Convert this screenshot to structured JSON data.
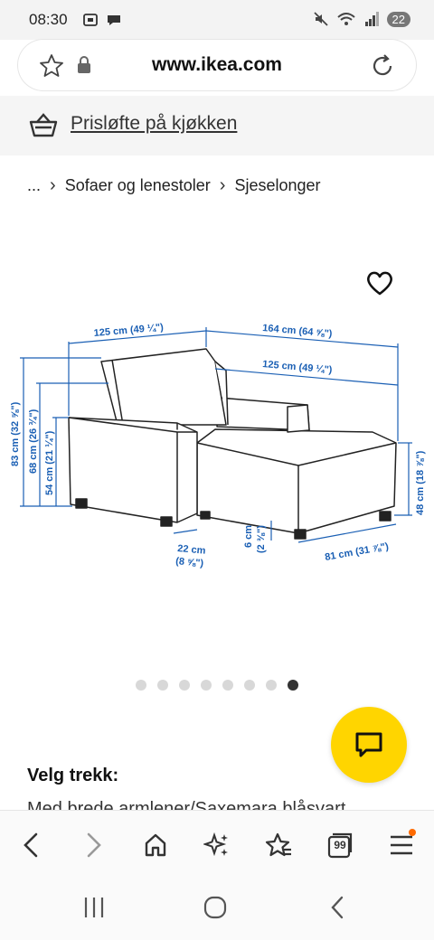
{
  "status_bar": {
    "time": "08:30",
    "battery": "22",
    "icons": [
      "screenshot-icon",
      "chat-bubble-icon",
      "mute-icon",
      "wifi-icon",
      "signal-icon"
    ]
  },
  "url_bar": {
    "url": "www.ikea.com",
    "icons": [
      "star-icon",
      "lock-icon",
      "reload-icon"
    ]
  },
  "promo": {
    "label": "Prisløfte på kjøkken",
    "icon": "basket-icon"
  },
  "breadcrumb": {
    "items": [
      "...",
      "Sofaer og lenestoler",
      "Sjeselonger"
    ],
    "separator": "›"
  },
  "product_image": {
    "dimensions": {
      "width_seat": "125 cm (49 ¼\")",
      "width_total": "164 cm (64 ⅝\")",
      "width_chaise": "125 cm (49 ¼\")",
      "height_back": "83 cm (32 ⅝\")",
      "height_arm": "68 cm (26 ¾\")",
      "height_seat_arm": "54 cm (21 ¼\")",
      "height_chaise": "48 cm (18 ⅞\")",
      "arm_width": "22 cm",
      "arm_width_in": "(8 ⅝\")",
      "leg_height": "6 cm",
      "leg_height_in": "(2 ⅜\")",
      "chaise_depth": "81 cm (31 ⅞\")"
    },
    "favorite_icon": "heart-icon"
  },
  "carousel": {
    "count": 8,
    "active_index": 7
  },
  "chat": {
    "icon": "chat-icon",
    "color": "#ffd500"
  },
  "content": {
    "section_title": "Velg trekk:",
    "cut_text": "Med brede armlener/Saxemara blåsvart"
  },
  "browser_nav": {
    "tab_count": "99",
    "icons": [
      "back-icon",
      "forward-icon",
      "home-icon",
      "sparkle-icon",
      "bookmarks-icon",
      "tabs-icon",
      "menu-icon"
    ]
  },
  "system_nav": {
    "icons": [
      "recents-icon",
      "home-circle-icon",
      "system-back-icon"
    ]
  },
  "colors": {
    "accent_yellow": "#ffd500",
    "dimension_blue": "#1a5fb4",
    "badge_orange": "#ff6a00"
  }
}
